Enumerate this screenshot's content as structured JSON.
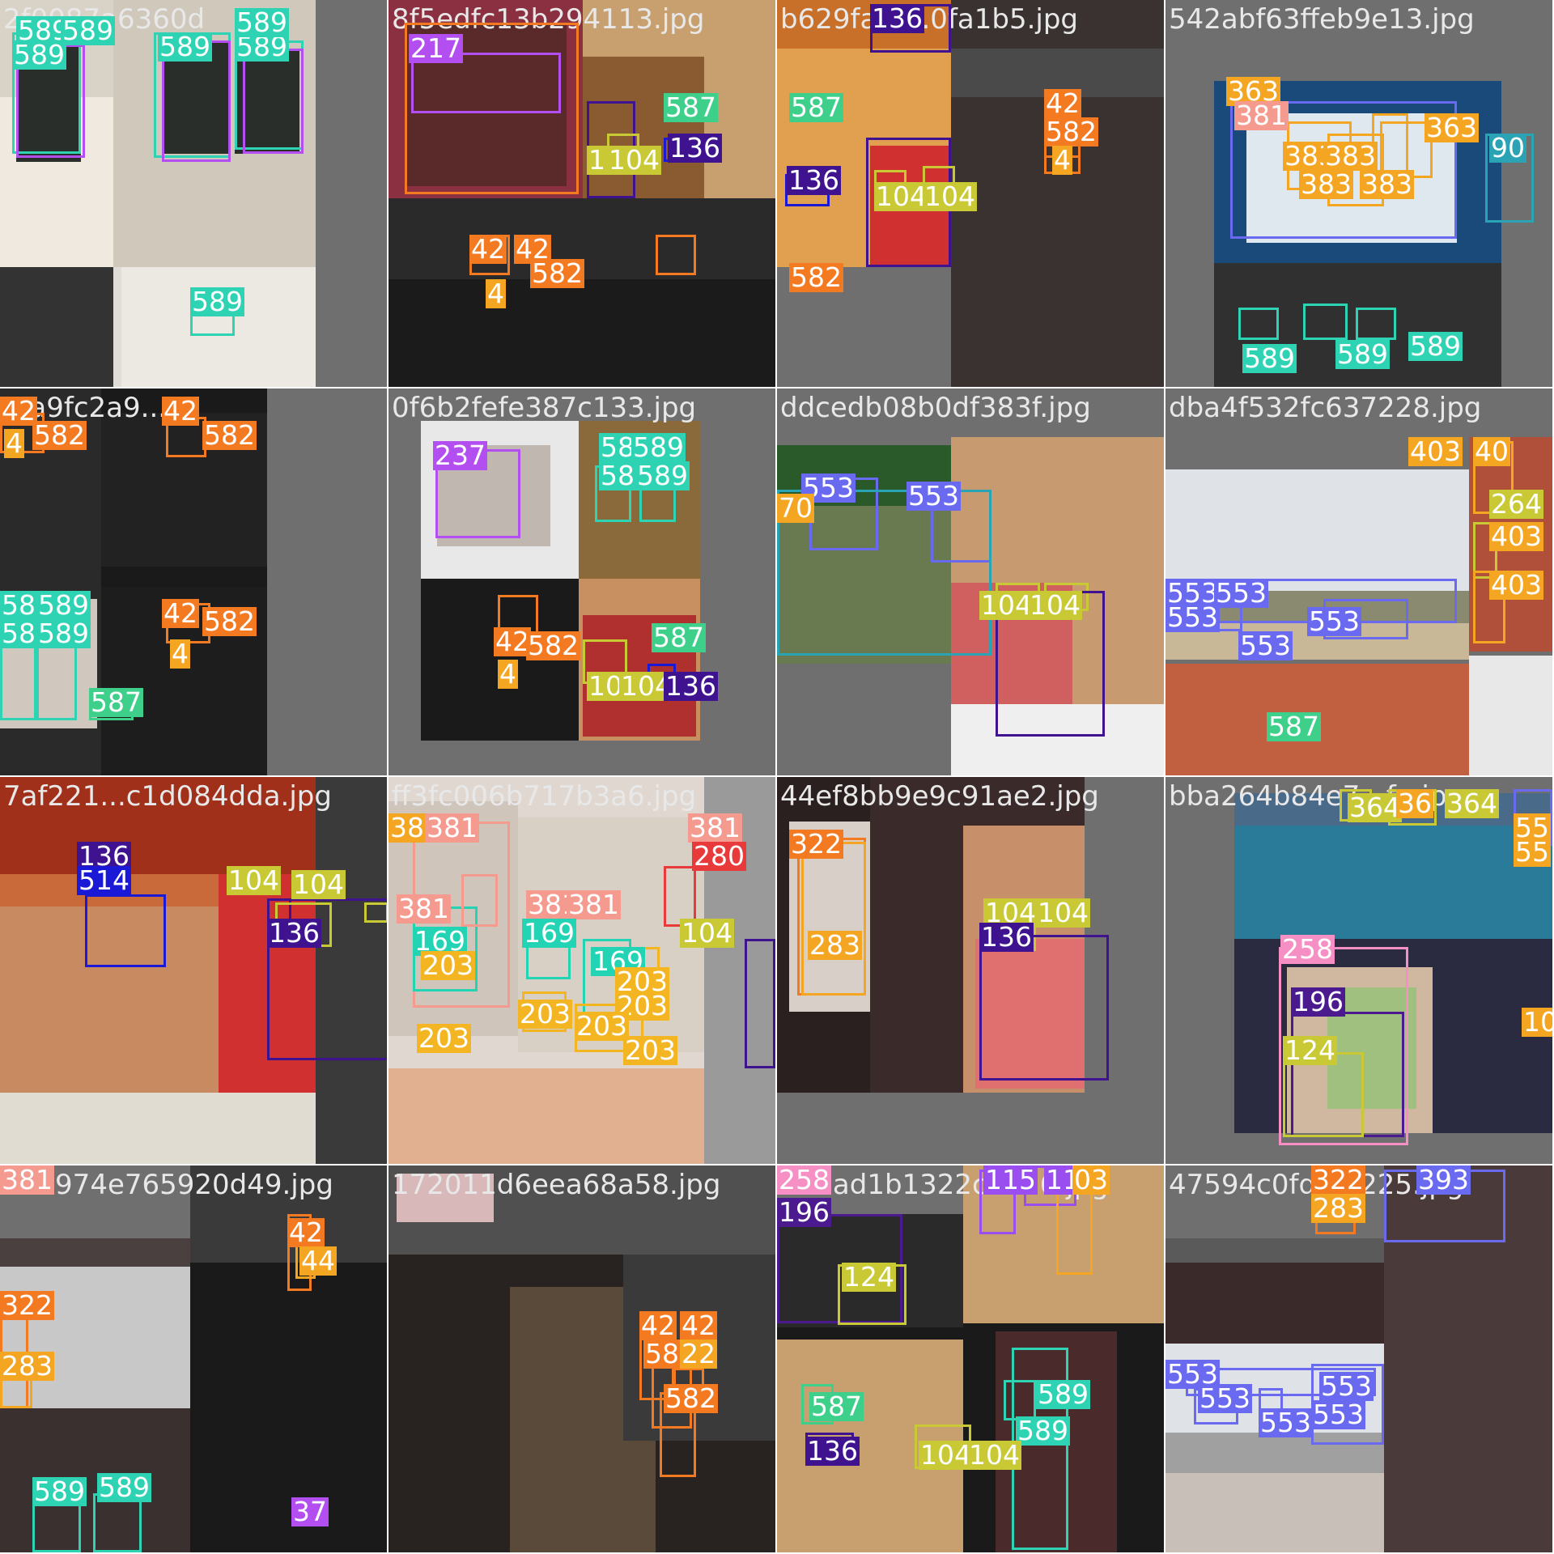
{
  "palette": {
    "c589": "#2ed3b4",
    "c104": "#c9c935",
    "c136": "#3f138f",
    "c514": "#1a1ad6",
    "c582": "#f47a22",
    "c42": "#f47a22",
    "c217": "#b34ef0",
    "c553": "#6a6af0",
    "c237": "#b34ef0",
    "c587": "#3ed08a",
    "c381": "#f59a8f",
    "c203": "#f4b522",
    "c169": "#22d3b4",
    "c258": "#f58fc4",
    "c196": "#4b1a8f",
    "c124": "#c9c935",
    "c322": "#f47a22",
    "c283": "#f4a522",
    "c393": "#6a6af0",
    "c115": "#9b4ef0",
    "c403": "#f4a522",
    "c363": "#f4a522",
    "c383": "#f4a522",
    "c364": "#c9c935",
    "c264": "#c9c935",
    "c90": "#2aa3b4",
    "c280": "#e83a3a",
    "c37": "#b34ef0"
  },
  "tiles": [
    {
      "filename": "2f0087a6360d",
      "labels": [
        "589",
        "589",
        "589",
        "589",
        "589",
        "589",
        "589"
      ]
    },
    {
      "filename": "8f5edfc13b294113.jpg",
      "labels": [
        "217",
        "587",
        "104",
        "104",
        "136",
        "42",
        "42",
        "582",
        "4"
      ]
    },
    {
      "filename": "b629faf1...0fa1b5.jpg",
      "labels": [
        "136",
        "587",
        "136",
        "104",
        "104",
        "582",
        "42",
        "582",
        "4"
      ]
    },
    {
      "filename": "542abf63ffeb9e13.jpg",
      "labels": [
        "363",
        "381",
        "363",
        "383",
        "383",
        "383",
        "383",
        "90",
        "589",
        "589",
        "589"
      ]
    },
    {
      "filename": "...a9fc2a9...",
      "labels": [
        "42",
        "582",
        "42",
        "582",
        "4",
        "589",
        "589",
        "589",
        "589",
        "42",
        "582",
        "4",
        "587"
      ]
    },
    {
      "filename": "0f6b2fefe387c133.jpg",
      "labels": [
        "237",
        "589",
        "589",
        "589",
        "589",
        "42",
        "582",
        "4",
        "587",
        "104",
        "104",
        "136"
      ]
    },
    {
      "filename": "ddcedb08b0df383f.jpg",
      "labels": [
        "553",
        "553",
        "70",
        "104",
        "104"
      ]
    },
    {
      "filename": "dba4f532fc637228.jpg",
      "labels": [
        "403",
        "40",
        "264",
        "403",
        "403",
        "553",
        "553",
        "553",
        "553",
        "553",
        "587"
      ]
    },
    {
      "filename": "7af221...c1d084dda.jpg",
      "labels": [
        "136",
        "514",
        "104",
        "104",
        "136"
      ]
    },
    {
      "filename": "ff3fc006b717b3a6.jpg",
      "labels": [
        "38",
        "381",
        "381",
        "280",
        "169",
        "381",
        "381",
        "381",
        "169",
        "169",
        "203",
        "203",
        "203",
        "203",
        "203",
        "203",
        "203",
        "104"
      ]
    },
    {
      "filename": "44ef8bb9e9c91ae2.jpg",
      "labels": [
        "322",
        "104",
        "104",
        "136",
        "283"
      ]
    },
    {
      "filename": "bba264b84e7...fe.jpg",
      "labels": [
        "364",
        "36",
        "364",
        "55",
        "55",
        "258",
        "196",
        "124",
        "10"
      ]
    },
    {
      "filename": "b3a974e765920d49.jpg",
      "labels": [
        "381",
        "42",
        "44",
        "322",
        "283",
        "589",
        "589",
        "37"
      ]
    },
    {
      "filename": "172011d6eea68a58.jpg",
      "labels": [
        "42",
        "42",
        "582",
        "22",
        "582"
      ]
    },
    {
      "filename": "630ad1b1322c8826.jpg",
      "labels": [
        "258",
        "115",
        "115",
        "03",
        "196",
        "124",
        "587",
        "589",
        "589",
        "136",
        "104",
        "104"
      ]
    },
    {
      "filename": "47594c0fd...3225.jpg",
      "labels": [
        "322",
        "393",
        "283",
        "553",
        "553",
        "553",
        "553",
        "553"
      ]
    }
  ]
}
